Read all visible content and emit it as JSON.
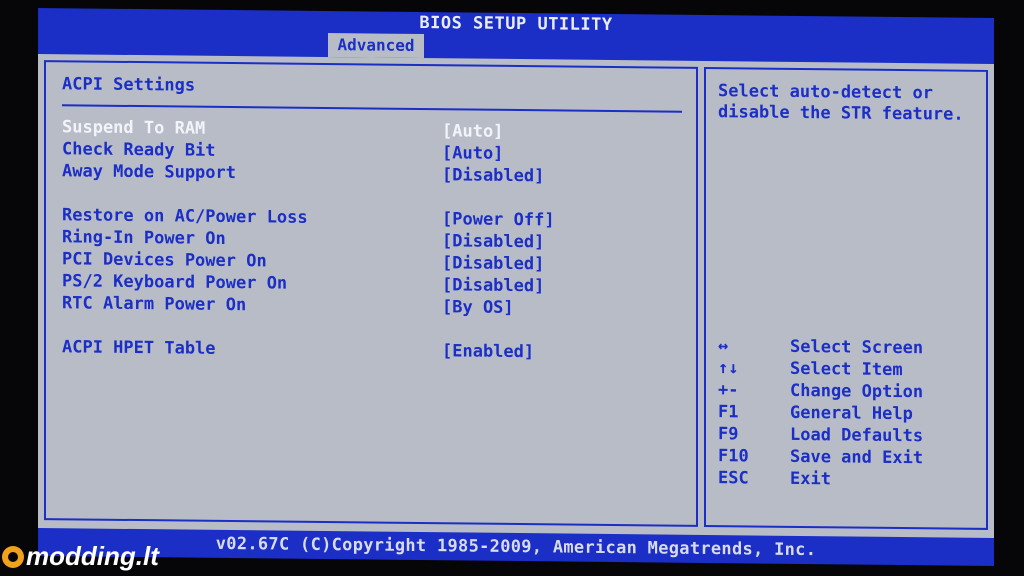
{
  "header": {
    "title": "BIOS SETUP UTILITY",
    "active_tab": "Advanced"
  },
  "panel": {
    "title": "ACPI Settings",
    "settings": [
      {
        "label": "Suspend To RAM",
        "value": "[Auto]",
        "selected": true
      },
      {
        "label": "Check Ready Bit",
        "value": "[Auto]",
        "selected": false
      },
      {
        "label": "Away Mode Support",
        "value": "[Disabled]",
        "selected": false
      },
      {
        "label": "Restore on AC/Power Loss",
        "value": "[Power Off]",
        "selected": false
      },
      {
        "label": "Ring-In Power On",
        "value": "[Disabled]",
        "selected": false
      },
      {
        "label": "PCI Devices Power On",
        "value": "[Disabled]",
        "selected": false
      },
      {
        "label": "PS/2 Keyboard Power On",
        "value": "[Disabled]",
        "selected": false
      },
      {
        "label": "RTC Alarm Power On",
        "value": "[By OS]",
        "selected": false
      },
      {
        "label": "ACPI HPET Table",
        "value": "[Enabled]",
        "selected": false
      }
    ]
  },
  "help": {
    "text": "Select auto-detect or disable the STR feature."
  },
  "keys": [
    {
      "key": "↔",
      "action": "Select Screen",
      "icon": "left-right-arrow-icon"
    },
    {
      "key": "↑↓",
      "action": "Select Item",
      "icon": "up-down-arrow-icon"
    },
    {
      "key": "+-",
      "action": "Change Option",
      "icon": "plus-minus-icon"
    },
    {
      "key": "F1",
      "action": "General Help"
    },
    {
      "key": "F9",
      "action": "Load Defaults"
    },
    {
      "key": "F10",
      "action": "Save and Exit"
    },
    {
      "key": "ESC",
      "action": "Exit"
    }
  ],
  "footer": {
    "text": "v02.67C (C)Copyright 1985-2009, American Megatrends, Inc."
  },
  "watermark": {
    "text": "modding.lt"
  },
  "colors": {
    "bios_blue": "#1b2ec6",
    "panel_gray": "#b8bcc6",
    "selected_text": "#f2f4fa"
  }
}
